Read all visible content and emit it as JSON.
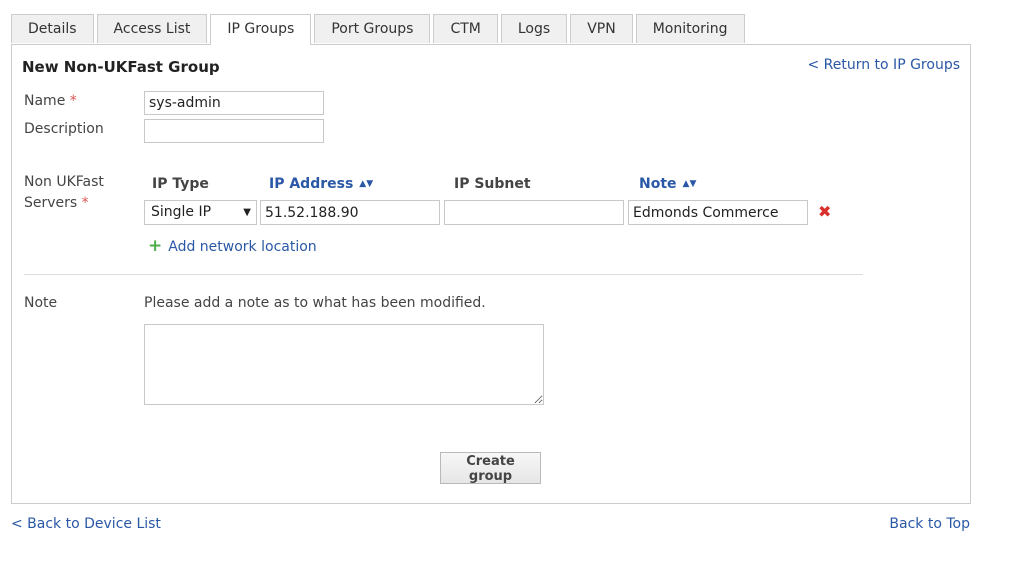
{
  "tabs": [
    {
      "label": "Details"
    },
    {
      "label": "Access List"
    },
    {
      "label": "IP Groups"
    },
    {
      "label": "Port Groups"
    },
    {
      "label": "CTM"
    },
    {
      "label": "Logs"
    },
    {
      "label": "VPN"
    },
    {
      "label": "Monitoring"
    }
  ],
  "active_tab": "IP Groups",
  "form": {
    "title": "New Non-UKFast Group",
    "return_link": "< Return to IP Groups",
    "name_label": "Name",
    "name_value": "sys-admin",
    "description_label": "Description",
    "description_value": "",
    "servers_label_line1": "Non UKFast",
    "servers_label_line2": "Servers",
    "required_marker": "*",
    "columns": {
      "ip_type": "IP Type",
      "ip_address": "IP Address",
      "ip_subnet": "IP Subnet",
      "note": "Note"
    },
    "row": {
      "ip_type": "Single IP",
      "ip_address": "51.52.188.90",
      "ip_subnet": "",
      "note": "Edmonds Commerce"
    },
    "add_location": "Add network location",
    "note_label": "Note",
    "note_hint": "Please add a note as to what has been modified.",
    "note_value": "",
    "submit": "Create group"
  },
  "footer": {
    "back_to_list": "< Back to Device List",
    "back_to_top": "Back to Top"
  },
  "colors": {
    "link": "#2a58a6",
    "required": "#d9534f",
    "remove": "#d9302c",
    "add": "#4cae4c"
  },
  "icons": {
    "sort": "sort-icon",
    "remove": "close-icon",
    "add": "plus-icon",
    "dropdown": "chevron-down-icon"
  }
}
